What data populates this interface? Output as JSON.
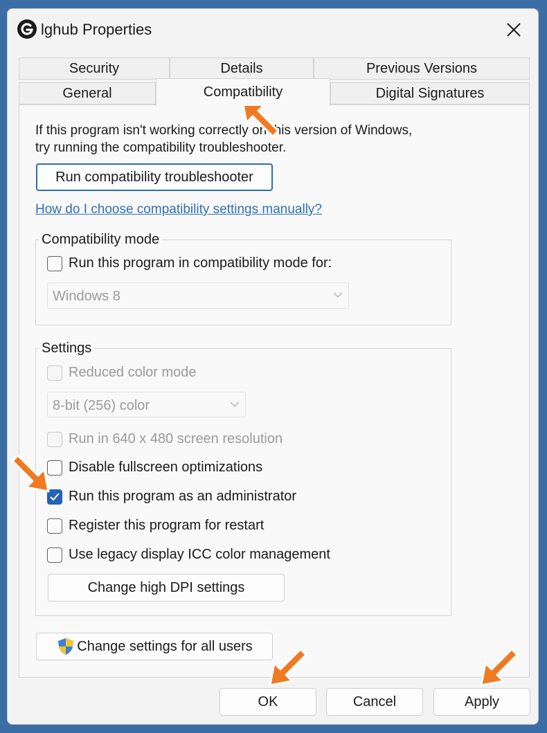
{
  "window": {
    "title": "lghub Properties"
  },
  "tabs": {
    "row1": [
      "Security",
      "Details",
      "Previous Versions"
    ],
    "row2": [
      "General",
      "Compatibility",
      "Digital Signatures"
    ],
    "active": "Compatibility"
  },
  "intro": {
    "line1": "If this program isn't working correctly on this version of Windows,",
    "line2": "try running the compatibility troubleshooter."
  },
  "troubleshooter_button": "Run compatibility troubleshooter",
  "manual_link": "How do I choose compatibility settings manually?",
  "compat_mode": {
    "label": "Compatibility mode",
    "checkbox": {
      "label": "Run this program in compatibility mode for:",
      "checked": false
    },
    "select": {
      "value": "Windows 8",
      "enabled": false
    }
  },
  "settings": {
    "label": "Settings",
    "reduced_color": {
      "label": "Reduced color mode",
      "checked": false,
      "enabled": false
    },
    "color_select": {
      "value": "8-bit (256) color",
      "enabled": false
    },
    "res640": {
      "label": "Run in 640 x 480 screen resolution",
      "checked": false,
      "enabled": false
    },
    "fullscreen": {
      "label": "Disable fullscreen optimizations",
      "checked": false,
      "enabled": true
    },
    "admin": {
      "label": "Run this program as an administrator",
      "checked": true,
      "enabled": true
    },
    "restart": {
      "label": "Register this program for restart",
      "checked": false,
      "enabled": true
    },
    "icc": {
      "label": "Use legacy display ICC color management",
      "checked": false,
      "enabled": true
    },
    "dpi_button": "Change high DPI settings"
  },
  "all_users_button": "Change settings for all users",
  "footer": {
    "ok": "OK",
    "cancel": "Cancel",
    "apply": "Apply"
  },
  "colors": {
    "accent": "#2462b8",
    "link": "#2f6fb5",
    "annotation_arrow": "#f07a22"
  }
}
